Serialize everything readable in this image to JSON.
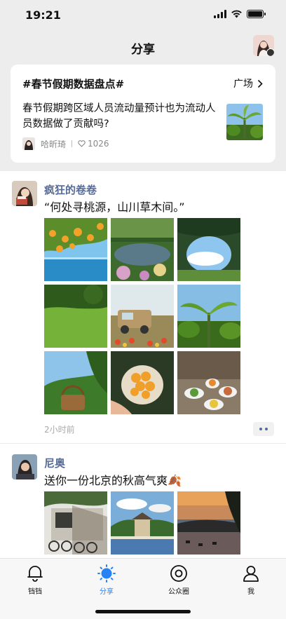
{
  "status": {
    "time": "19:21",
    "battery_level": 1.0
  },
  "nav": {
    "title": "分享"
  },
  "topic": {
    "title": "#春节假期数据盘点#",
    "link_label": "广场",
    "text": "春节假期跨区域人员流动量预计也为流动人员数据做了贡献吗?",
    "author": "哈昕琦",
    "likes": "1026"
  },
  "posts": [
    {
      "name": "疯狂的卷卷",
      "text": "“何处寻桃源，山川草木间。”",
      "time": "2小时前",
      "images": [
        "orange-tree-sea",
        "garden-pond",
        "cave-sky",
        "green-field",
        "vintage-truck",
        "banana-plants",
        "fruit-basket",
        "apricots-bowl",
        "table-dishes"
      ]
    },
    {
      "name": "尼奥",
      "text": "送你一份北京的秋高气爽🍂",
      "images": [
        "courtyard-bicycles",
        "lake-pavilion",
        "sunset-lake"
      ]
    }
  ],
  "tabs": [
    {
      "label": "铛铛",
      "icon": "bell-icon"
    },
    {
      "label": "分享",
      "icon": "sun-icon",
      "active": true
    },
    {
      "label": "公众圈",
      "icon": "circle-icon"
    },
    {
      "label": "我",
      "icon": "person-icon"
    }
  ],
  "colors": {
    "accent": "#2783f5",
    "link": "#576b95"
  }
}
